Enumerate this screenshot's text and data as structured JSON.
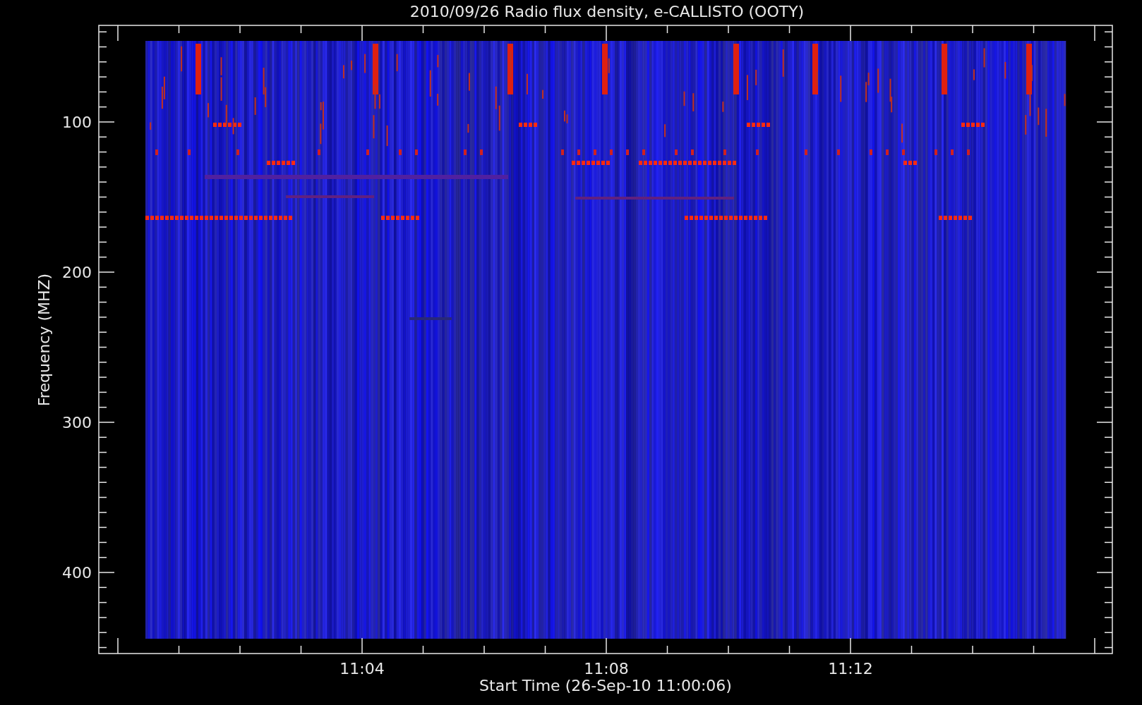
{
  "chart": {
    "title": "2010/09/26  Radio flux density, e-CALLISTO (OOTY)",
    "ylabel": "Frequency (MHZ)",
    "xlabel": "Start Time (26-Sep-10 11:00:06)",
    "y_ticks": [
      "100",
      "200",
      "300",
      "400"
    ],
    "x_ticks": [
      "11:04",
      "11:08",
      "11:12"
    ]
  }
}
